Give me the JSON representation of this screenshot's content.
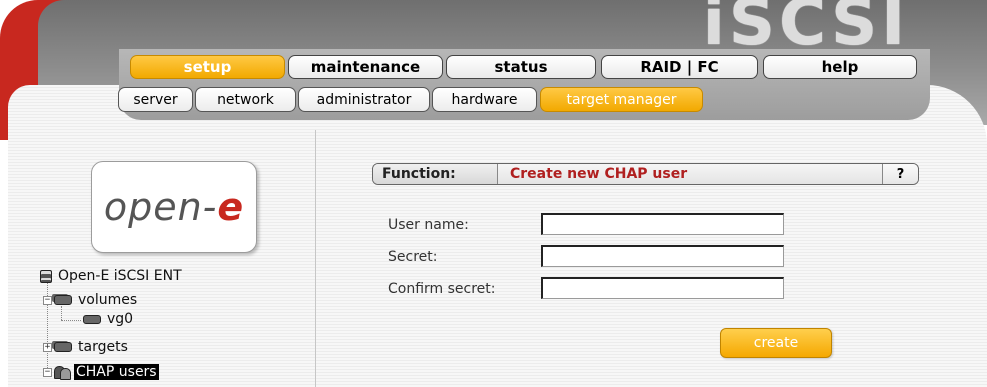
{
  "header": {
    "brand": "iSCSI",
    "main_tabs": [
      {
        "label": "setup",
        "active": true
      },
      {
        "label": "maintenance",
        "active": false
      },
      {
        "label": "status",
        "active": false
      },
      {
        "label": "RAID | FC",
        "active": false
      },
      {
        "label": "help",
        "active": false
      }
    ],
    "sub_tabs": [
      {
        "label": "server",
        "active": false
      },
      {
        "label": "network",
        "active": false
      },
      {
        "label": "administrator",
        "active": false
      },
      {
        "label": "hardware",
        "active": false
      },
      {
        "label": "target manager",
        "active": true
      }
    ]
  },
  "sidebar": {
    "logo_text": "open-",
    "logo_accent": "e",
    "tree": {
      "root": "Open-E iSCSI ENT",
      "volumes": "volumes",
      "vg0": "vg0",
      "targets": "targets",
      "chap_users": "CHAP users"
    }
  },
  "main": {
    "function_label": "Function:",
    "function_title": "Create new CHAP user",
    "help": "?",
    "form": {
      "user_name_label": "User name:",
      "user_name_value": "",
      "secret_label": "Secret:",
      "secret_value": "",
      "confirm_label": "Confirm secret:",
      "confirm_value": ""
    },
    "create_label": "create"
  },
  "colors": {
    "accent_orange": "#f5a800",
    "brand_red": "#c8281f",
    "function_title": "#b02020"
  }
}
